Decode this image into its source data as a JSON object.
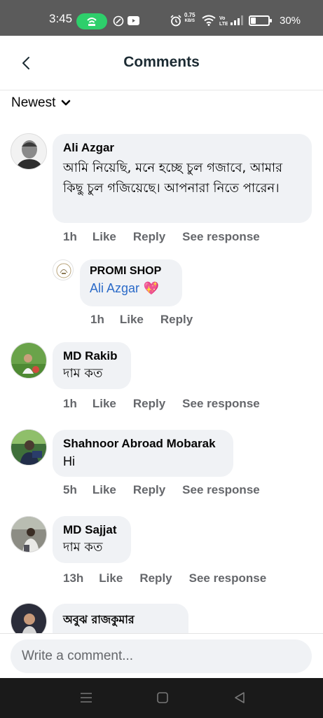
{
  "status_bar": {
    "time": "3:45",
    "net_speed_value": "0.75",
    "net_speed_unit": "KB/S",
    "battery_percent": "30%",
    "battery_level": 0.3
  },
  "header": {
    "title": "Comments"
  },
  "sort": {
    "label": "Newest"
  },
  "comments": [
    {
      "author": "Ali Azgar",
      "text": "আমি নিয়েছি, মনে হচ্ছে চুল গজাবে, আমার কিছু চুল গজিয়েছে। আপনারা নিতে পারেন।",
      "time": "1h",
      "like": "Like",
      "reply": "Reply",
      "see_response": "See response",
      "reply_item": {
        "author": "PROMI SHOP",
        "mention": "Ali Azgar",
        "emoji": "💖",
        "time": "1h",
        "like": "Like",
        "reply": "Reply"
      }
    },
    {
      "author": "MD Rakib",
      "text": "দাম কত",
      "time": "1h",
      "like": "Like",
      "reply": "Reply",
      "see_response": "See response"
    },
    {
      "author": "Shahnoor Abroad Mobarak",
      "text": "Hi",
      "time": "5h",
      "like": "Like",
      "reply": "Reply",
      "see_response": "See response"
    },
    {
      "author": "MD Sajjat",
      "text": "দাম কত",
      "time": "13h",
      "like": "Like",
      "reply": "Reply",
      "see_response": "See response"
    },
    {
      "author": "অবুঝ রাজকুমার"
    }
  ],
  "composer": {
    "placeholder": "Write a comment..."
  }
}
